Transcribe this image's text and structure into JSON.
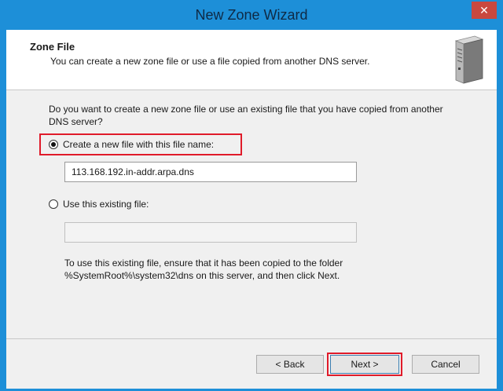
{
  "window": {
    "title": "New Zone Wizard",
    "close_label": "✕"
  },
  "header": {
    "title": "Zone File",
    "subtitle": "You can create a new zone file or use a file copied from another DNS server.",
    "icon": "server-icon"
  },
  "content": {
    "question": "Do you want to create a new zone file or use an existing file that you have copied from another DNS server?",
    "option_new": {
      "label": "Create a new file with this file name:",
      "selected": true,
      "value": "113.168.192.in-addr.arpa.dns"
    },
    "option_existing": {
      "label": "Use this existing file:",
      "selected": false,
      "value": ""
    },
    "note": "To use this existing file, ensure that it has been copied to the folder %SystemRoot%\\system32\\dns on this server, and then click Next."
  },
  "footer": {
    "back_label": "< Back",
    "next_label": "Next >",
    "cancel_label": "Cancel"
  },
  "colors": {
    "titlebar": "#1d8fd8",
    "highlight": "#e01b2a"
  }
}
